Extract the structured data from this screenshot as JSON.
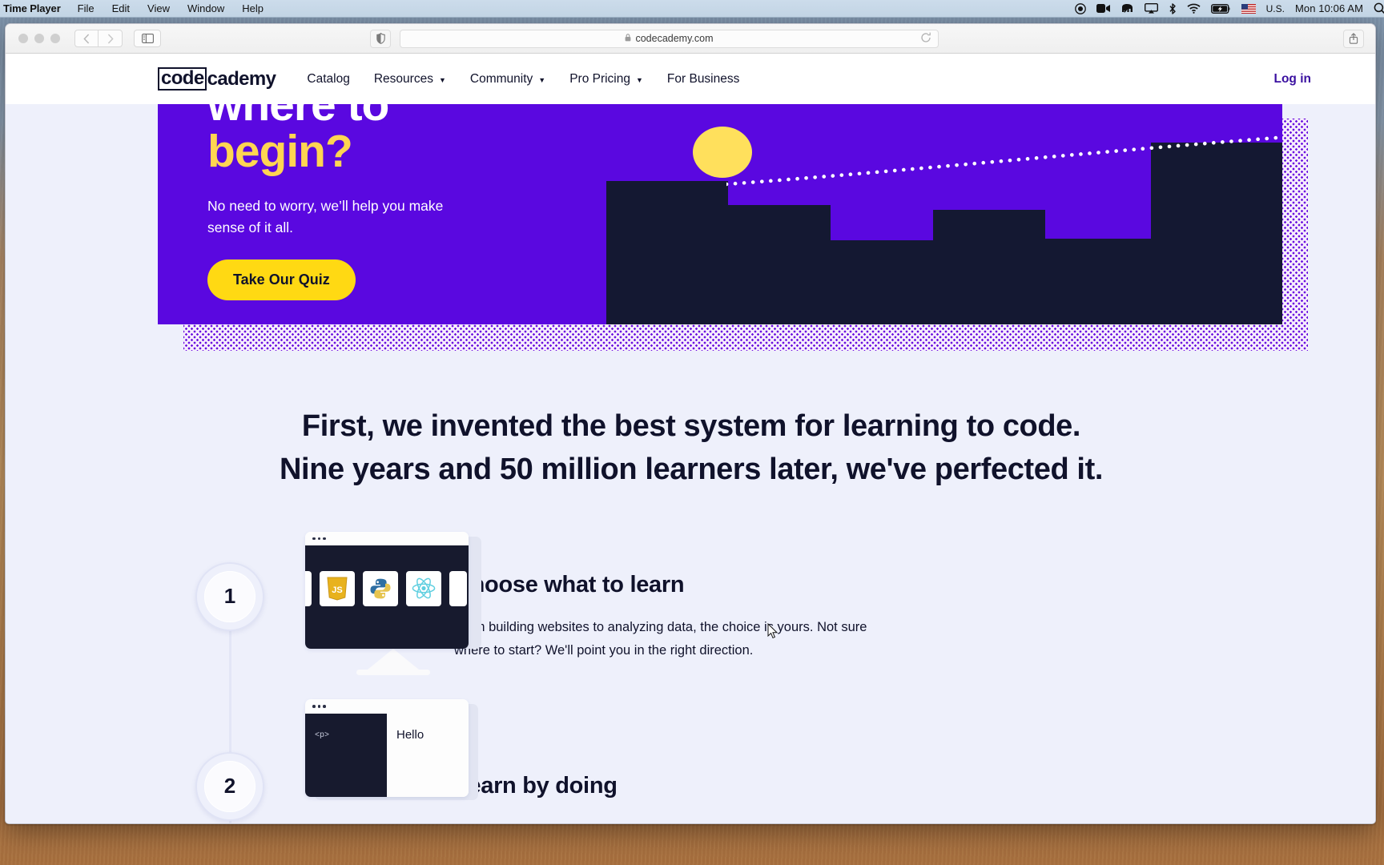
{
  "menubar": {
    "app_name": "Time Player",
    "items": [
      "File",
      "Edit",
      "View",
      "Window",
      "Help"
    ],
    "status_icons": [
      "record-icon",
      "video-camera-icon",
      "elephant-icon",
      "airplay-icon",
      "bluetooth-icon",
      "wifi-icon",
      "battery-charging-icon"
    ],
    "input_flag": "us-flag-icon",
    "input_language": "U.S.",
    "clock": "Mon 10:06 AM",
    "search_icon": "spotlight-search-icon"
  },
  "browser": {
    "window_controls": [
      "close-button",
      "minimize-button",
      "zoom-button"
    ],
    "back_icon": "chevron-left-icon",
    "forward_icon": "chevron-right-icon",
    "sidebar_icon": "sidebar-toggle-icon",
    "shield_icon": "privacy-shield-icon",
    "url": "codecademy.com",
    "lock_icon": "lock-icon",
    "reload_icon": "reload-icon",
    "share_icon": "share-icon"
  },
  "site": {
    "logo_boxed": "code",
    "logo_rest": "cademy",
    "nav": [
      {
        "label": "Catalog",
        "has_caret": false
      },
      {
        "label": "Resources",
        "has_caret": true
      },
      {
        "label": "Community",
        "has_caret": true
      },
      {
        "label": "Pro Pricing",
        "has_caret": true
      },
      {
        "label": "For Business",
        "has_caret": false
      }
    ],
    "login_label": "Log in"
  },
  "hero": {
    "title_line1": "where to",
    "title_line2": "begin?",
    "subtitle": "No need to worry, we’ll help you make sense of it all.",
    "cta_label": "Take Our Quiz",
    "bg_color": "#5a08e0",
    "accent_yellow": "#ffd552",
    "block_color": "#141832",
    "button_color": "#ffd913",
    "illustration": [
      "sun-circle-icon",
      "dotted-trajectory-line",
      "city-blocks-shape"
    ]
  },
  "headline": {
    "line1": "First, we invented the best system for learning to code.",
    "line2": "Nine years and 50 million learners later, we've perfected it."
  },
  "steps": [
    {
      "number": "1",
      "title": "Choose what to learn",
      "description": "From building websites to analyzing data, the choice is yours. Not sure where to start? We'll point you in the right direction.",
      "art": "monitor-with-language-tiles",
      "tiles": [
        "javascript-icon",
        "python-icon",
        "react-icon"
      ]
    },
    {
      "number": "2",
      "title": "Learn by doing",
      "description": "",
      "art": "browser-window-code-preview",
      "code_text": "<p>",
      "preview_text": "Hello"
    }
  ],
  "colors": {
    "page_bg": "#eef0fb",
    "text_dark": "#10122b",
    "link_purple": "#3a10a0"
  }
}
